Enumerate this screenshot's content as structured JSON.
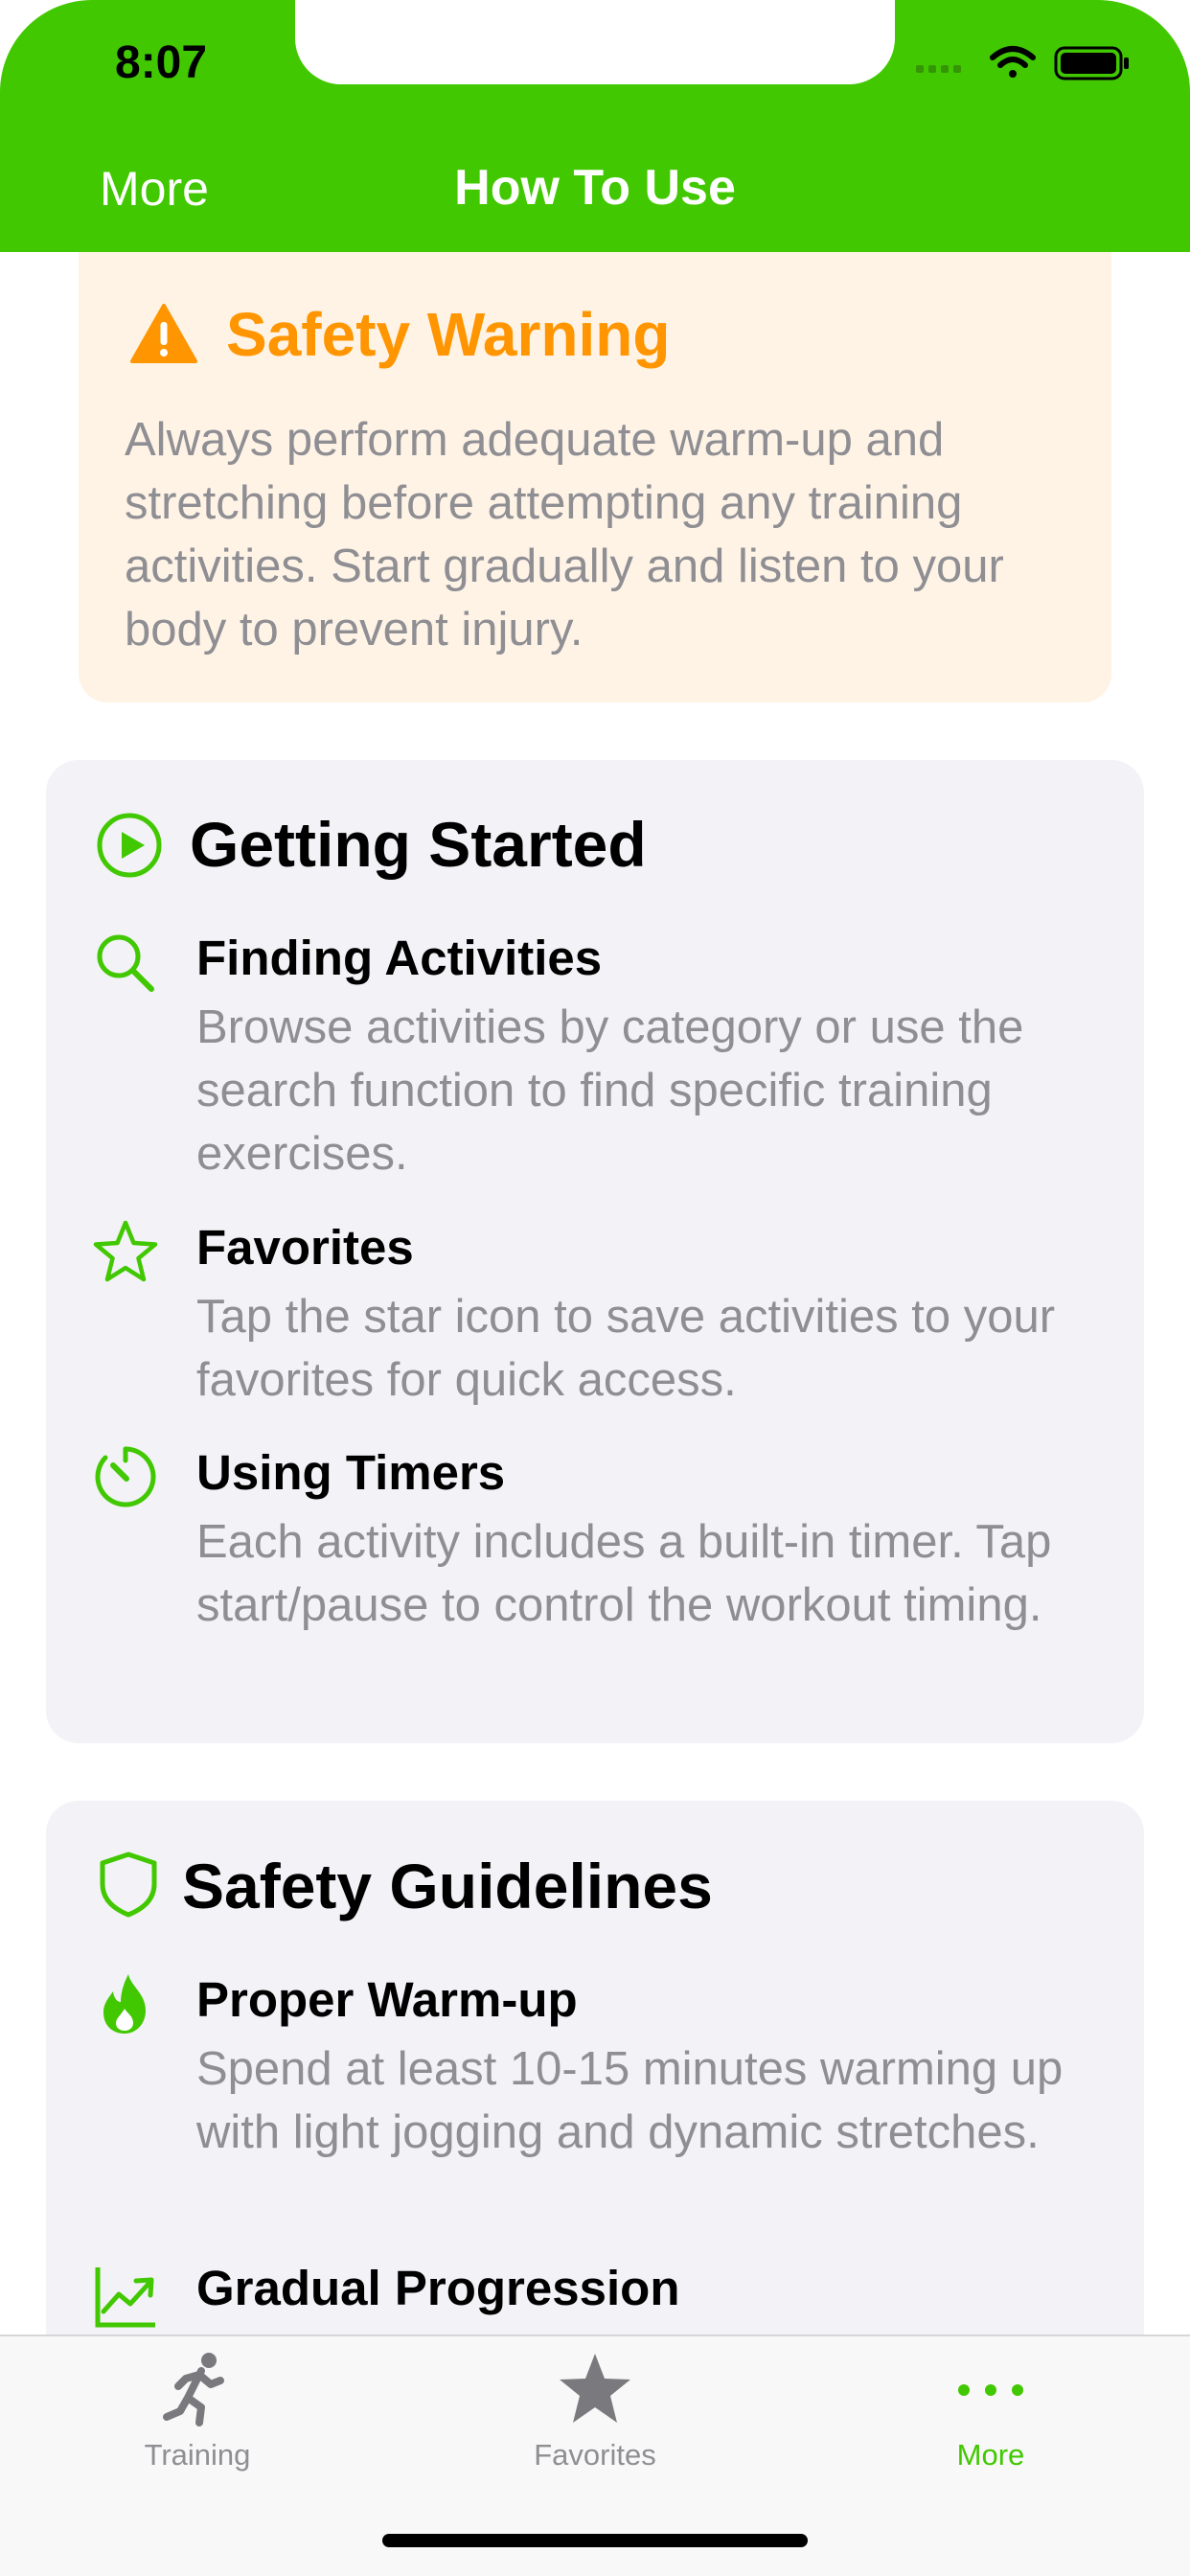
{
  "status_bar": {
    "time": "8:07"
  },
  "nav": {
    "back_label": "More",
    "title": "How To Use"
  },
  "warning": {
    "icon": "warning-triangle-icon",
    "title": "Safety Warning",
    "text": "Always perform adequate warm-up and stretching before attempting any training activities. Start gradually and listen to your body to prevent injury."
  },
  "sections": [
    {
      "icon": "play-circle-icon",
      "title": "Getting Started",
      "items": [
        {
          "icon": "search-icon",
          "title": "Finding Activities",
          "description": "Browse activities by category or use the search function to find specific training exercises."
        },
        {
          "icon": "star-icon",
          "title": "Favorites",
          "description": "Tap the star icon to save activities to your favorites for quick access."
        },
        {
          "icon": "timer-icon",
          "title": "Using Timers",
          "description": "Each activity includes a built-in timer. Tap start/pause to control the workout timing."
        }
      ]
    },
    {
      "icon": "shield-icon",
      "title": "Safety Guidelines",
      "items": [
        {
          "icon": "flame-icon",
          "title": "Proper Warm-up",
          "description": "Spend at least 10-15 minutes warming up with light jogging and dynamic stretches."
        },
        {
          "icon": "chart-up-icon",
          "title": "Gradual Progression",
          "description": ""
        }
      ]
    }
  ],
  "tabs": [
    {
      "icon": "running-figure-icon",
      "label": "Training",
      "active": false
    },
    {
      "icon": "star-filled-icon",
      "label": "Favorites",
      "active": false
    },
    {
      "icon": "more-dots-icon",
      "label": "More",
      "active": true
    }
  ],
  "colors": {
    "accent": "#41C800",
    "warning": "#FF9500",
    "warning_background": "#FFF3E6",
    "card_background": "#F2F2F7",
    "secondary_text": "#8E8E93"
  }
}
